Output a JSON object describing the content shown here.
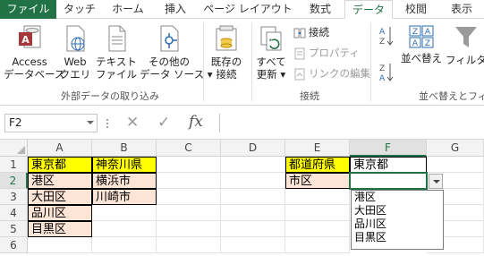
{
  "tabs": [
    {
      "label": "ファイル",
      "state": "file"
    },
    {
      "label": "タッチ",
      "state": ""
    },
    {
      "label": "ホーム",
      "state": ""
    },
    {
      "label": "挿入",
      "state": ""
    },
    {
      "label": "ページ レイアウト",
      "state": ""
    },
    {
      "label": "数式",
      "state": ""
    },
    {
      "label": "データ",
      "state": "active"
    },
    {
      "label": "校閲",
      "state": ""
    },
    {
      "label": "表示",
      "state": ""
    }
  ],
  "ribbon": {
    "external": {
      "access": {
        "line1": "Access",
        "line2": "データベース"
      },
      "web": {
        "line1": "Web",
        "line2": "クエリ"
      },
      "text": {
        "line1": "テキスト",
        "line2": "ファイル"
      },
      "other": {
        "line1": "その他の",
        "line2": "データ ソース"
      },
      "group_label": "外部データの取り込み"
    },
    "existing": {
      "line1": "既存の",
      "line2": "接続"
    },
    "connections": {
      "refresh": {
        "line1": "すべて",
        "line2": "更新"
      },
      "connections": "接続",
      "properties": "プロパティ",
      "edit_links": "リンクの編集",
      "group_label": "接続"
    },
    "sort": {
      "sort_label": "並べ替え",
      "filter_label": "フィルター",
      "group_label": "並べ替えとフィ"
    }
  },
  "formula_bar": {
    "name_box": "F2",
    "fx": "fx",
    "value": ""
  },
  "columns": [
    "A",
    "B",
    "C",
    "D",
    "E",
    "F",
    "G"
  ],
  "rows": [
    "1",
    "2",
    "3",
    "4",
    "5",
    "6"
  ],
  "cells": {
    "A1": "東京都",
    "A2": "港区",
    "A3": "大田区",
    "A4": "品川区",
    "A5": "目黒区",
    "B1": "神奈川県",
    "B2": "横浜市",
    "B3": "川崎市",
    "E1": "都道府県",
    "E2": "市区",
    "F1": "東京都",
    "F2": ""
  },
  "selected_cell": "F2",
  "dropdown": {
    "items": [
      "港区",
      "大田区",
      "品川区",
      "目黒区"
    ]
  },
  "colors": {
    "accent": "#217346",
    "header_fill": "#ffff00",
    "data_fill": "#fce4d6"
  }
}
